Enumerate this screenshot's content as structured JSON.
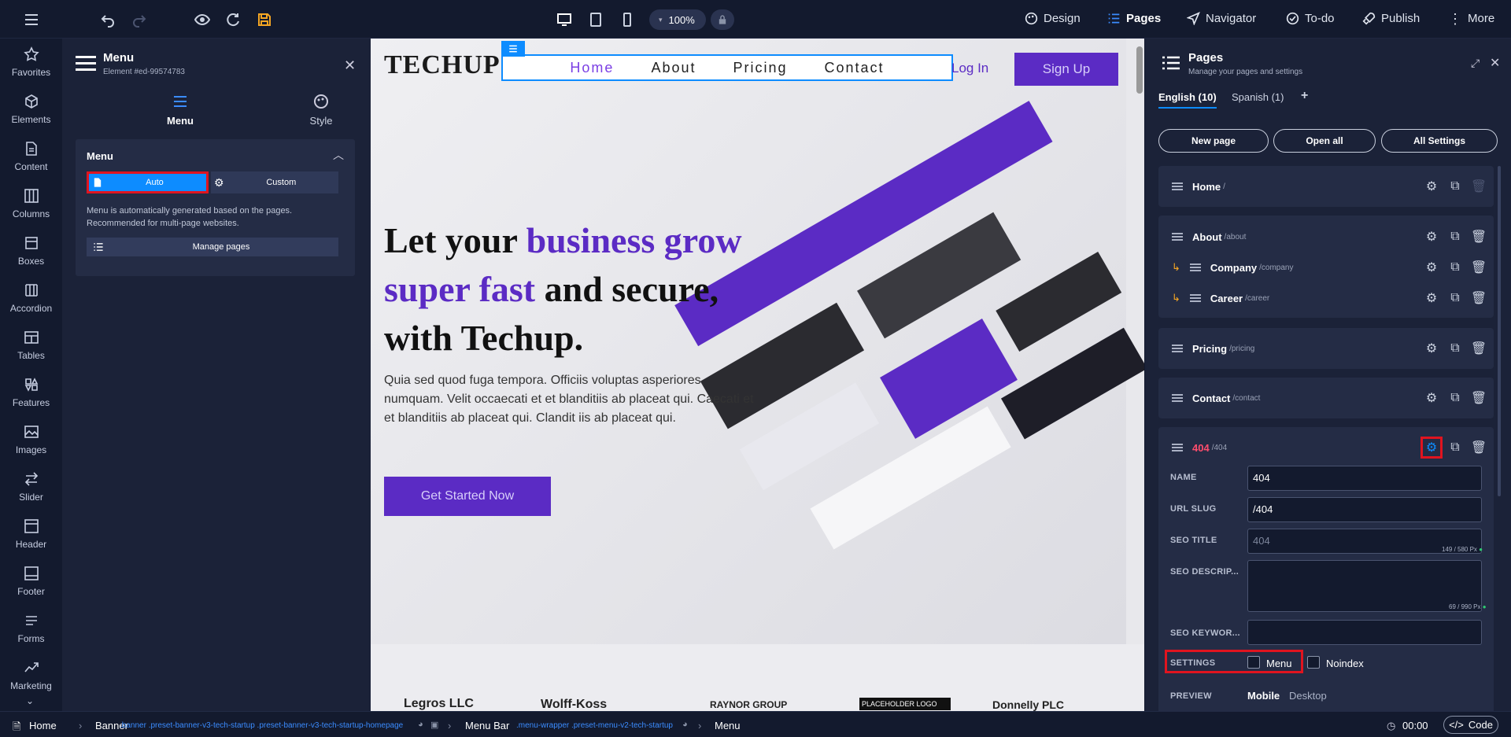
{
  "topbar": {
    "zoom": "100%",
    "nav": [
      {
        "label": "Design"
      },
      {
        "label": "Pages"
      },
      {
        "label": "Navigator"
      },
      {
        "label": "To-do"
      },
      {
        "label": "Publish"
      },
      {
        "label": "More"
      }
    ]
  },
  "leftbar": {
    "items": [
      "Favorites",
      "Elements",
      "Content",
      "Columns",
      "Boxes",
      "Accordion",
      "Tables",
      "Features",
      "Images",
      "Slider",
      "Header",
      "Footer",
      "Forms",
      "Marketing"
    ]
  },
  "menu_panel": {
    "title": "Menu",
    "subtitle": "Element #ed-99574783",
    "tabs": [
      "Menu",
      "Style"
    ],
    "section_title": "Menu",
    "auto_label": "Auto",
    "custom_label": "Custom",
    "description": "Menu is automatically generated based on the pages. Recommended for multi-page websites.",
    "manage_label": "Manage pages"
  },
  "canvas": {
    "logo": "TECHUP",
    "nav": [
      "Home",
      "About",
      "Pricing",
      "Contact"
    ],
    "login": "Log In",
    "signup": "Sign Up",
    "headline_1": "Let your ",
    "headline_accent": "business grow super fast",
    "headline_2": " and secure, with Techup.",
    "body": "Quia sed quod fuga tempora. Officiis voluptas asperiores numquam. Velit occaecati et et blanditiis ab placeat qui. Caecati et et blanditiis ab placeat qui. Clandit iis ab placeat qui.",
    "cta": "Get Started Now",
    "partners": [
      "Legros LLC",
      "Wolff-Koss",
      "RAYNOR GROUP",
      "PLACEHOLDER LOGO",
      "Donnelly PLC"
    ]
  },
  "pages_panel": {
    "title": "Pages",
    "subtitle": "Manage your pages and settings",
    "lang_tabs": [
      "English (10)",
      "Spanish (1)",
      "+"
    ],
    "buttons": [
      "New page",
      "Open all",
      "All Settings"
    ],
    "pages": [
      {
        "name": "Home",
        "slug": "/"
      },
      {
        "name": "About",
        "slug": "/about"
      },
      {
        "name": "Company",
        "slug": "/company"
      },
      {
        "name": "Career",
        "slug": "/career"
      },
      {
        "name": "Pricing",
        "slug": "/pricing"
      },
      {
        "name": "Contact",
        "slug": "/contact"
      },
      {
        "name": "404",
        "slug": "/404"
      }
    ],
    "form": {
      "name_label": "NAME",
      "name_value": "404",
      "slug_label": "URL SLUG",
      "slug_value": "/404",
      "seo_title_label": "SEO TITLE",
      "seo_title_placeholder": "404",
      "seo_title_counter": "149 / 580 Px",
      "seo_desc_label": "SEO DESCRIP...",
      "seo_desc_counter": "69 / 990 Px",
      "seo_kw_label": "SEO KEYWOR...",
      "settings_label": "SETTINGS",
      "menu_label": "Menu",
      "noindex_label": "Noindex",
      "preview_label": "PREVIEW",
      "preview_mobile": "Mobile",
      "preview_desktop": "Desktop"
    }
  },
  "statusbar": {
    "home": "Home",
    "banner": "Banner",
    "banner_classes": ".banner .preset-banner-v3-tech-startup .preset-banner-v3-tech-startup-homepage",
    "menubar": "Menu Bar",
    "menubar_classes": ".menu-wrapper .preset-menu-v2-tech-startup",
    "menu": "Menu",
    "time": "00:00",
    "code": "Code"
  },
  "colors": {
    "accent": "#0d8cff",
    "purple": "#5b2bc4",
    "highlight": "#e0141f",
    "error": "#ff4d6d"
  }
}
